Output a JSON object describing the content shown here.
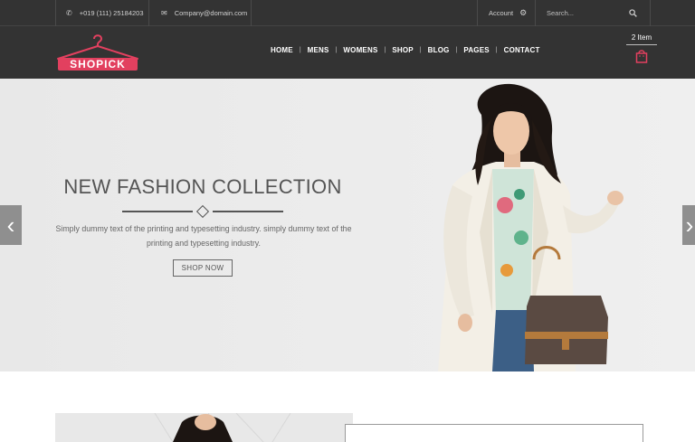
{
  "topbar": {
    "phone": "+019 (111) 25184203",
    "email": "Company@domain.com",
    "account": "Account",
    "search_placeholder": "Search..."
  },
  "brand": {
    "name": "SHOPICK",
    "accent_color": "#e2405f"
  },
  "nav": {
    "items": [
      "HOME",
      "MENS",
      "WOMENS",
      "SHOP",
      "BLOG",
      "PAGES",
      "CONTACT"
    ]
  },
  "cart": {
    "count_label": "2 Item"
  },
  "hero": {
    "title": "NEW FASHION COLLECTION",
    "text_line1": "Simply dummy text of the printing and typesetting industry. simply dummy text of the",
    "text_line2": "printing and typesetting industry.",
    "button": "SHOP NOW",
    "prev_icon": "chevron-left-icon",
    "next_icon": "chevron-right-icon"
  },
  "icons": {
    "phone": "phone-icon",
    "email": "envelope-icon",
    "settings": "gear-icon",
    "search": "search-icon",
    "cart": "shopping-bag-icon"
  }
}
